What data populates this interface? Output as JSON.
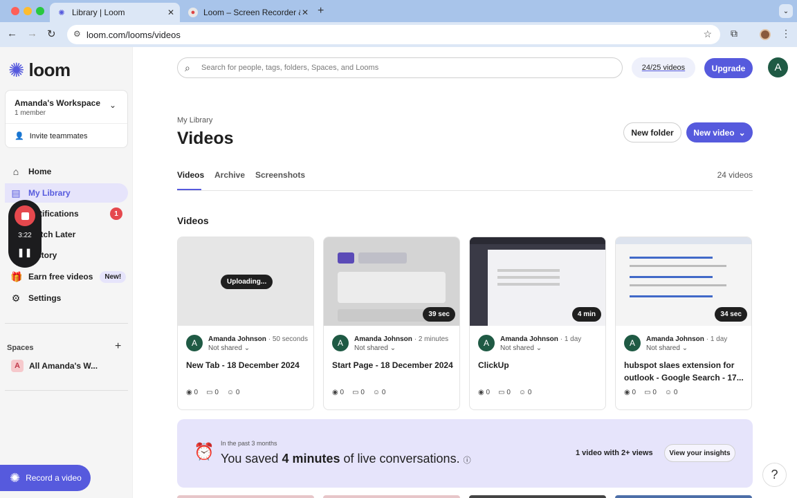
{
  "browser": {
    "tabs": [
      {
        "title": "Library | Loom"
      },
      {
        "title": "Loom – Screen Recorder & Sc"
      }
    ],
    "url": "loom.com/looms/videos"
  },
  "sidebar": {
    "logo": "loom",
    "workspace": {
      "name": "Amanda's Workspace",
      "members": "1 member",
      "invite": "Invite teammates"
    },
    "nav": [
      {
        "label": "Home"
      },
      {
        "label": "My Library"
      },
      {
        "label": "Notifications",
        "badge": "1"
      },
      {
        "label": "Watch Later"
      },
      {
        "label": "History"
      },
      {
        "label": "Earn free videos",
        "badge": "New!"
      },
      {
        "label": "Settings"
      }
    ],
    "recording_timer": "3:22",
    "spaces_label": "Spaces",
    "space_item": {
      "initial": "A",
      "label": "All Amanda's W..."
    },
    "record_button": "Record a video"
  },
  "header": {
    "search_placeholder": "Search for people, tags, folders, Spaces, and Looms",
    "quota": "24/25 videos",
    "upgrade": "Upgrade",
    "avatar_initial": "A"
  },
  "page": {
    "breadcrumb": "My Library",
    "title": "Videos",
    "new_folder": "New folder",
    "new_video": "New video",
    "tabs": [
      "Videos",
      "Archive",
      "Screenshots"
    ],
    "video_count": "24 videos",
    "section_title": "Videos"
  },
  "videos": [
    {
      "author": "Amanda Johnson",
      "time": "50 seconds",
      "share": "Not shared",
      "title": "New Tab - 18 December 2024",
      "status": "Uploading...",
      "duration": "",
      "views": "0",
      "comments": "0",
      "reactions": "0"
    },
    {
      "author": "Amanda Johnson",
      "time": "2 minutes",
      "share": "Not shared",
      "title": "Start Page - 18 December 2024",
      "status": "",
      "duration": "39 sec",
      "views": "0",
      "comments": "0",
      "reactions": "0"
    },
    {
      "author": "Amanda Johnson",
      "time": "1 day",
      "share": "Not shared",
      "title": "ClickUp",
      "status": "",
      "duration": "4 min",
      "views": "0",
      "comments": "0",
      "reactions": "0"
    },
    {
      "author": "Amanda Johnson",
      "time": "1 day",
      "share": "Not shared",
      "title": "hubspot slaes extension for outlook - Google Search - 17...",
      "status": "",
      "duration": "34 sec",
      "views": "0",
      "comments": "0",
      "reactions": "0"
    }
  ],
  "insights": {
    "period": "In the past 3 months",
    "saved_prefix": "You saved",
    "saved_amount": "4 minutes",
    "saved_suffix": "of live conversations.",
    "views_stat": "1 video with 2+ views",
    "button": "View your insights"
  },
  "help": "?",
  "colors": {
    "accent": "#565ADD",
    "recording": "#e5484d",
    "avatar": "#1f5a44"
  }
}
